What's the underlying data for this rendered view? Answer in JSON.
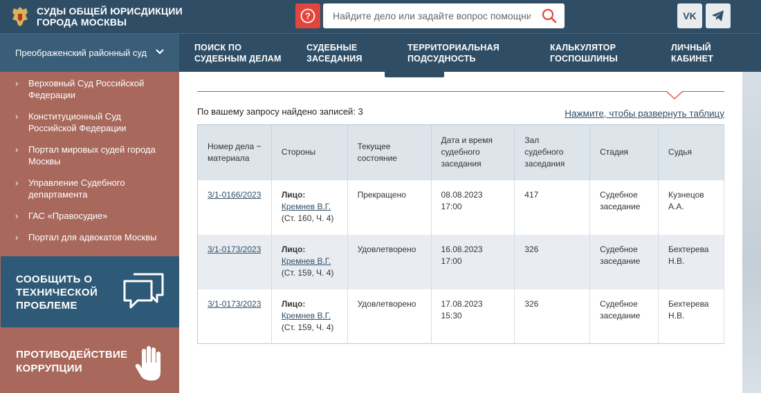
{
  "header": {
    "site_title": "СУДЫ ОБЩЕЙ ЮРИСДИКЦИИ ГОРОДА МОСКВЫ",
    "search_placeholder": "Найдите дело или задайте вопрос помощнику",
    "help_glyph": "?",
    "social_vk": "VK",
    "accent": "#e2453b",
    "bar_color": "#2f4e66"
  },
  "nav": {
    "court_selector": "Преображенский районный суд",
    "items": [
      "ПОИСК ПО СУДЕБНЫМ ДЕЛАМ",
      "СУДЕБНЫЕ ЗАСЕДАНИЯ",
      "ТЕРРИТОРИАЛЬНАЯ ПОДСУДНОСТЬ",
      "КАЛЬКУЛЯТОР ГОСПОШЛИНЫ",
      "ЛИЧНЫЙ КАБИНЕТ"
    ]
  },
  "sidebar": {
    "links": [
      "Верховный Суд Российской Федерации",
      "Конституционный Суд Российской Федерации",
      "Портал мировых судей города Москвы",
      "Управление Судебного департамента",
      "ГАС «Правосудие»",
      "Портал для адвокатов Москвы"
    ],
    "report_problem": "СООБЩИТЬ О ТЕХНИЧЕСКОЙ ПРОБЛЕМЕ",
    "anti_corruption": "ПРОТИВОДЕЙСТВИЕ КОРРУПЦИИ"
  },
  "results": {
    "found_text": "По вашему запросу найдено записей: 3",
    "expand_link": "Нажмите, чтобы развернуть таблицу",
    "columns": [
      "Номер дела ~ материала",
      "Стороны",
      "Текущее состояние",
      "Дата и время судебного заседания",
      "Зал судебного заседания",
      "Стадия",
      "Судья"
    ],
    "rows": [
      {
        "case_number": "3/1-0166/2023",
        "party_label": "Лицо:",
        "party_name": "Кремнев В.Г.",
        "party_article": "(Ст. 160, Ч. 4)",
        "status": "Прекращено",
        "datetime": "08.08.2023 17:00",
        "hall": "417",
        "stage": "Судебное заседание",
        "judge": "Кузнецов А.А."
      },
      {
        "case_number": "3/1-0173/2023",
        "party_label": "Лицо:",
        "party_name": "Кремнев В.Г.",
        "party_article": "(Ст. 159, Ч. 4)",
        "status": "Удовлетворено",
        "datetime": "16.08.2023 17:00",
        "hall": "326",
        "stage": "Судебное заседание",
        "judge": "Бехтерева Н.В."
      },
      {
        "case_number": "3/1-0173/2023",
        "party_label": "Лицо:",
        "party_name": "Кремнев В.Г.",
        "party_article": "(Ст. 159, Ч. 4)",
        "status": "Удовлетворено",
        "datetime": "17.08.2023 15:30",
        "hall": "326",
        "stage": "Судебное заседание",
        "judge": "Бехтерева Н.В."
      }
    ]
  }
}
